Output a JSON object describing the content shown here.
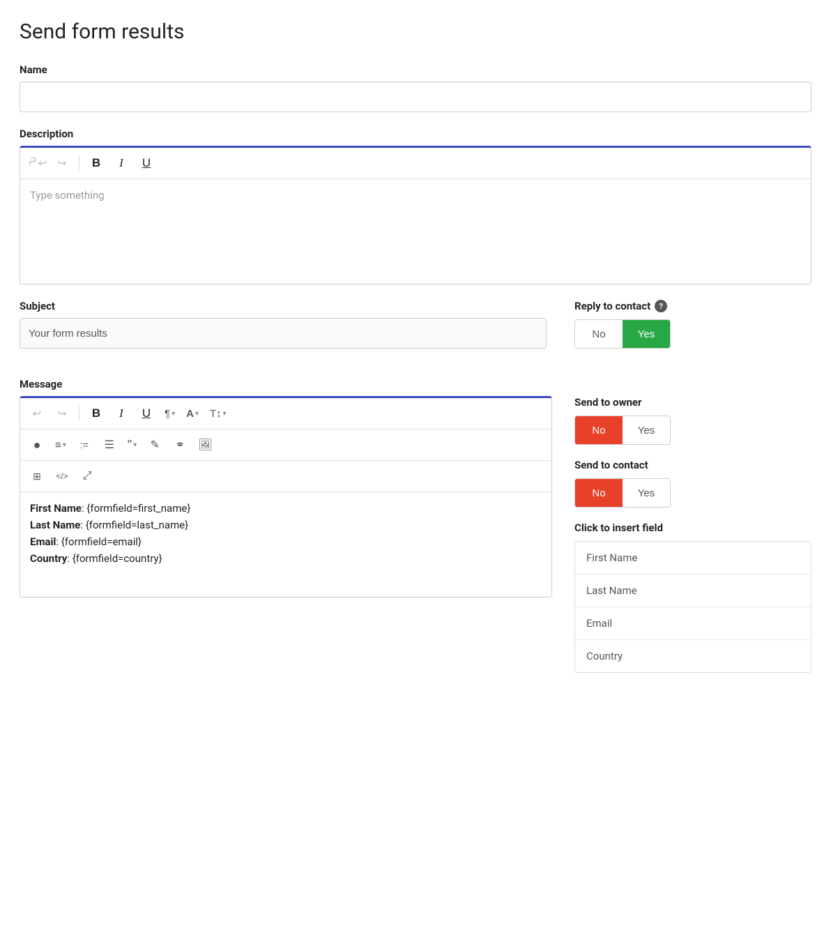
{
  "page": {
    "title": "Send form results"
  },
  "name_field": {
    "label": "Name",
    "value": "",
    "placeholder": ""
  },
  "description_field": {
    "label": "Description",
    "placeholder": "Type something",
    "toolbar": {
      "undo": "↩",
      "redo": "↪",
      "bold": "B",
      "italic": "I",
      "underline": "U"
    }
  },
  "subject_field": {
    "label": "Subject",
    "value": "Your form results"
  },
  "reply_to_contact": {
    "label": "Reply to contact",
    "no_label": "No",
    "yes_label": "Yes",
    "active": "yes"
  },
  "message_field": {
    "label": "Message",
    "content": [
      {
        "bold_part": "First Name",
        "value_part": ": {formfield=first_name}"
      },
      {
        "bold_part": "Last Name",
        "value_part": ": {formfield=last_name}"
      },
      {
        "bold_part": "Email",
        "value_part": ": {formfield=email}"
      },
      {
        "bold_part": "Country",
        "value_part": ": {formfield=country}"
      }
    ]
  },
  "send_to_owner": {
    "label": "Send to owner",
    "no_label": "No",
    "yes_label": "Yes",
    "active": "no"
  },
  "send_to_contact": {
    "label": "Send to contact",
    "no_label": "No",
    "yes_label": "Yes",
    "active": "no"
  },
  "insert_field": {
    "title": "Click to insert field",
    "items": [
      "First Name",
      "Last Name",
      "Email",
      "Country"
    ]
  },
  "toolbar": {
    "undo_label": "⟲",
    "redo_label": "⟳",
    "bold_label": "B",
    "italic_label": "I",
    "underline_label": "U",
    "paragraph_label": "¶",
    "font_color_label": "A",
    "font_size_label": "T↕",
    "color_fill_label": "◉",
    "align_label": "≡",
    "ordered_list_label": "≡·",
    "unordered_list_label": "☰",
    "blockquote_label": "❝",
    "highlight_label": "✎",
    "link_label": "🔗",
    "image_label": "🖼",
    "table_label": "⊞",
    "code_label": "</>",
    "fullscreen_label": "⤢"
  }
}
